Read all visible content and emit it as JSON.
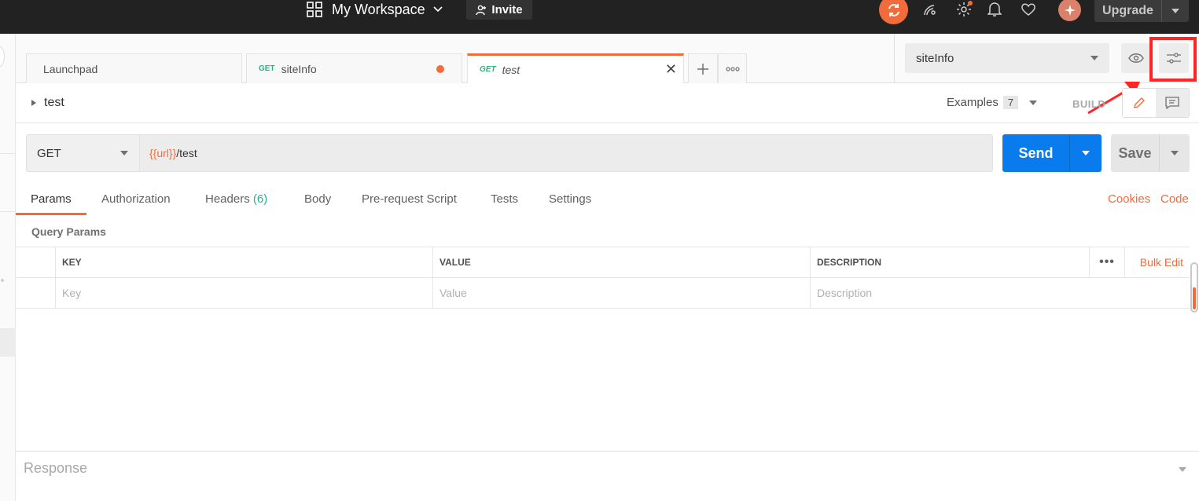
{
  "topbar": {
    "workspace_name": "My Workspace",
    "invite_label": "Invite",
    "upgrade_label": "Upgrade"
  },
  "tabs": [
    {
      "label": "Launchpad",
      "method": ""
    },
    {
      "label": "siteInfo",
      "method": "GET",
      "unsaved": true
    },
    {
      "label": "test",
      "method": "GET",
      "active": true
    }
  ],
  "environment": {
    "selected": "siteInfo"
  },
  "request": {
    "name": "test",
    "examples_label": "Examples",
    "examples_count": "7",
    "build_label": "BUILD",
    "method": "GET",
    "url_variable": "{{url}}",
    "url_path": "/test",
    "send_label": "Send",
    "save_label": "Save"
  },
  "subtabs": {
    "params": "Params",
    "authorization": "Authorization",
    "headers": "Headers",
    "headers_count": "(6)",
    "body": "Body",
    "prerequest": "Pre-request Script",
    "tests": "Tests",
    "settings": "Settings",
    "cookies": "Cookies",
    "code": "Code"
  },
  "params": {
    "section_title": "Query Params",
    "columns": [
      "KEY",
      "VALUE",
      "DESCRIPTION"
    ],
    "bulk_edit": "Bulk Edit",
    "placeholders": {
      "key": "Key",
      "value": "Value",
      "description": "Description"
    }
  },
  "response": {
    "title": "Response"
  },
  "colors": {
    "accent": "#f26b3a",
    "send": "#097bed",
    "method_green": "#26b47f",
    "highlight_red": "#ff2525"
  }
}
